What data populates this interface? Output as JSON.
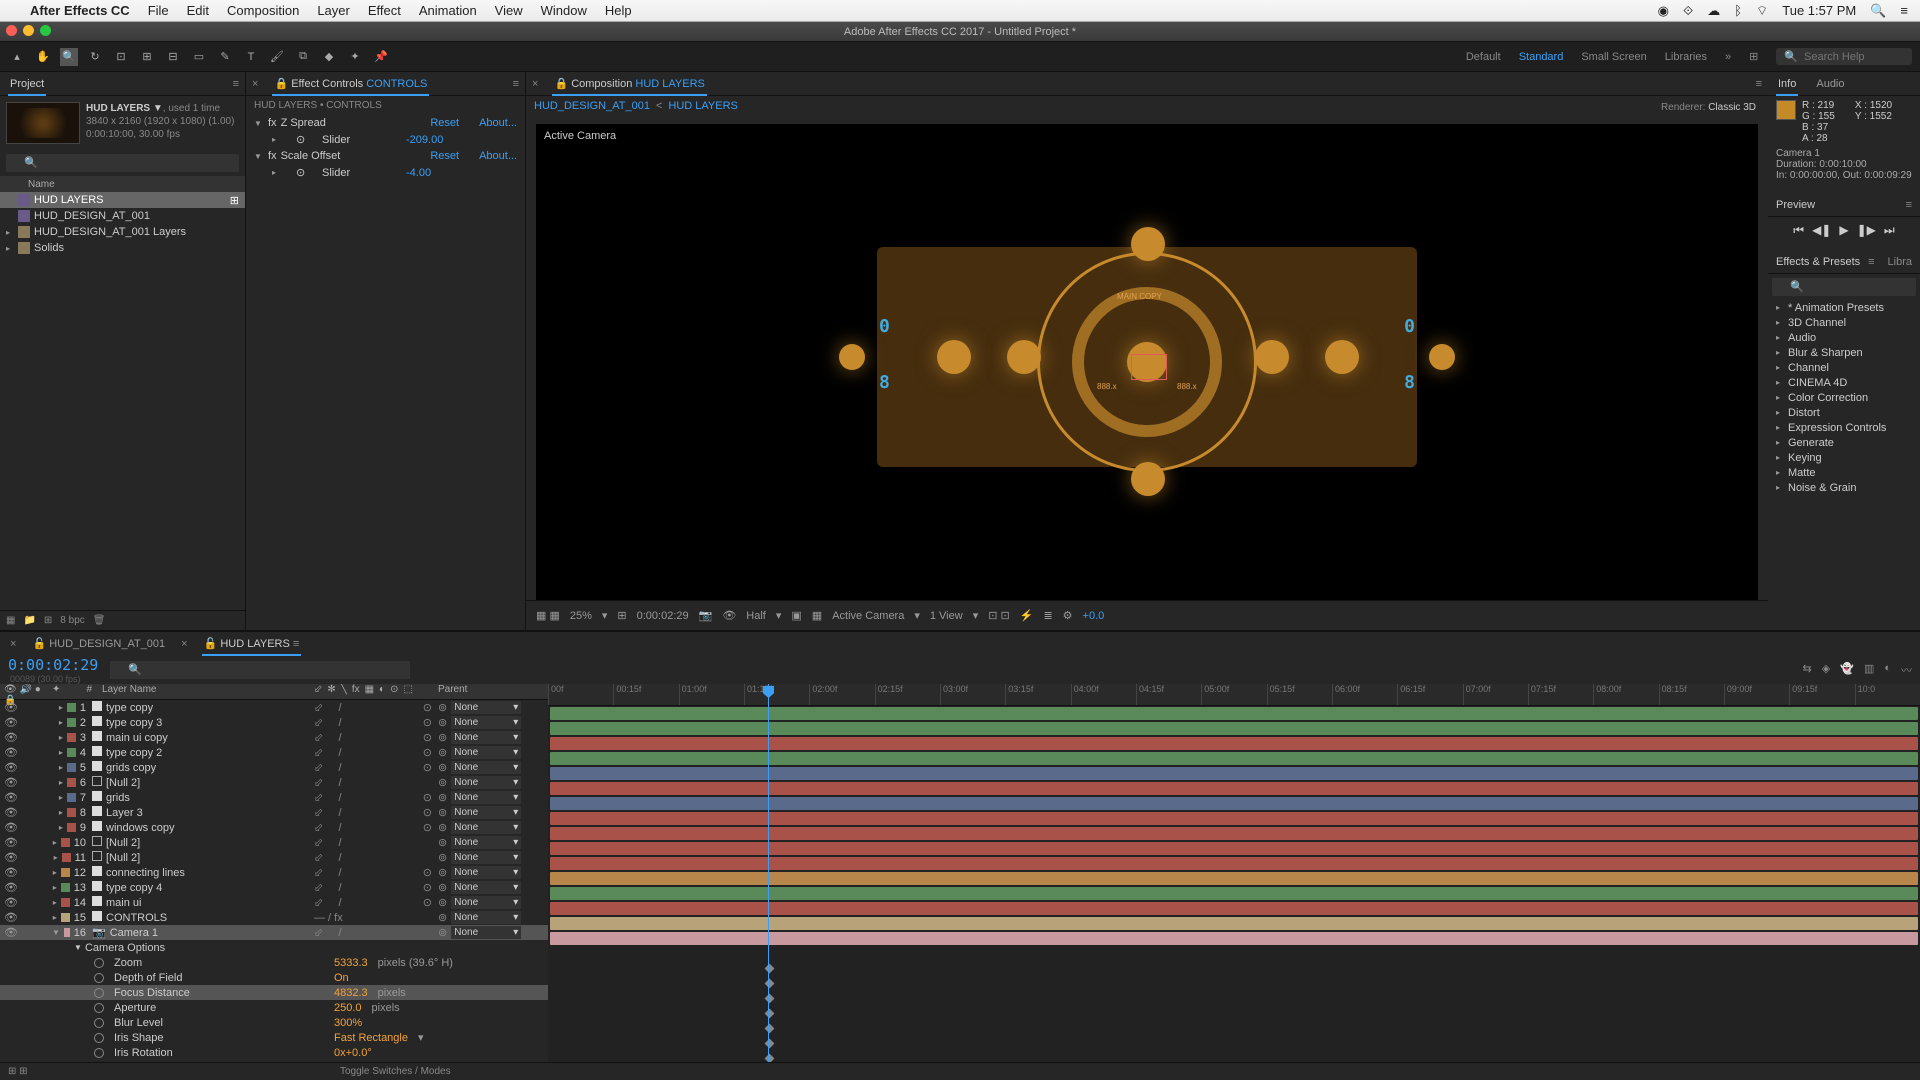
{
  "menubar": {
    "app": "After Effects CC",
    "items": [
      "File",
      "Edit",
      "Composition",
      "Layer",
      "Effect",
      "Animation",
      "View",
      "Window",
      "Help"
    ],
    "status_time": "Tue 1:57 PM"
  },
  "document_title": "Adobe After Effects CC 2017 - Untitled Project *",
  "workspaces": {
    "default": "Default",
    "standard": "Standard",
    "small": "Small Screen",
    "libraries": "Libraries",
    "search_placeholder": "Search Help"
  },
  "project": {
    "tab": "Project",
    "footage_name": "HUD LAYERS ▼",
    "footage_used": ", used 1 time",
    "res": "3840 x 2160  (1920 x 1080) (1.00)",
    "dur": "0:00:10:00, 30.00 fps",
    "column_header": "Name",
    "items": [
      {
        "name": "HUD LAYERS",
        "type": "comp",
        "sel": true,
        "indent": 0
      },
      {
        "name": "HUD_DESIGN_AT_001",
        "type": "comp",
        "sel": false,
        "indent": 0
      },
      {
        "name": "HUD_DESIGN_AT_001 Layers",
        "type": "folder",
        "sel": false,
        "indent": 0,
        "closed": true
      },
      {
        "name": "Solids",
        "type": "folder",
        "sel": false,
        "indent": 0,
        "closed": true
      }
    ],
    "footer_bpc": "8 bpc"
  },
  "effect_controls": {
    "tab_label": "Effect Controls",
    "tab_target": "CONTROLS",
    "path": "HUD LAYERS • CONTROLS",
    "effects": [
      {
        "name": "Z Spread",
        "reset": "Reset",
        "about": "About...",
        "slider_label": "Slider",
        "slider_val": "-209.00"
      },
      {
        "name": "Scale Offset",
        "reset": "Reset",
        "about": "About...",
        "slider_label": "Slider",
        "slider_val": "-4.00"
      }
    ]
  },
  "composition": {
    "tab_label": "Composition",
    "tab_target": "HUD LAYERS",
    "path_a": "HUD_DESIGN_AT_001",
    "path_sep": "<",
    "path_b": "HUD LAYERS",
    "renderer_label": "Renderer:",
    "renderer_val": "Classic 3D",
    "active_cam": "Active Camera",
    "hud": {
      "left_num": "0",
      "left_num2": "8",
      "right_num": "0",
      "right_num2": "8",
      "main": "MAIN COPY",
      "aux": "888.x"
    },
    "footer": {
      "mag": "25%",
      "time": "0:00:02:29",
      "res": "Half",
      "cam": "Active Camera",
      "views": "1 View",
      "exposure": "+0.0"
    }
  },
  "info": {
    "tab_info": "Info",
    "tab_audio": "Audio",
    "r": "R : 219",
    "g": "G : 155",
    "b": "B : 37",
    "a": "A : 28",
    "x": "X : 1520",
    "y": "Y : 1552",
    "cam": "Camera 1",
    "dur": "Duration:  0:00:10:00",
    "in_out": "In: 0:00:00:00, Out: 0:00:09:29"
  },
  "preview": {
    "tab": "Preview"
  },
  "effects_presets": {
    "tab": "Effects & Presets",
    "tab2": "Libra",
    "items": [
      "* Animation Presets",
      "3D Channel",
      "Audio",
      "Blur & Sharpen",
      "Channel",
      "CINEMA 4D",
      "Color Correction",
      "Distort",
      "Expression Controls",
      "Generate",
      "Keying",
      "Matte",
      "Noise & Grain"
    ]
  },
  "timeline": {
    "tabs": [
      {
        "name": "HUD_DESIGN_AT_001",
        "active": false
      },
      {
        "name": "HUD LAYERS",
        "active": true
      }
    ],
    "timecode": "0:00:02:29",
    "timecode_sub": "00089 (30.00 fps)",
    "columns": {
      "layer_name": "Layer Name",
      "parent": "Parent"
    },
    "ruler": [
      "00f",
      "00:15f",
      "01:00f",
      "01:15f",
      "02:00f",
      "02:15f",
      "03:00f",
      "03:15f",
      "04:00f",
      "04:15f",
      "05:00f",
      "05:15f",
      "06:00f",
      "06:15f",
      "07:00f",
      "07:15f",
      "08:00f",
      "08:15f",
      "09:00f",
      "09:15f",
      "10:0"
    ],
    "layers": [
      {
        "idx": "1",
        "color": "#5a8a5a",
        "name": "type copy",
        "ico": "solid",
        "bar": "green",
        "parent": "None",
        "threed": true
      },
      {
        "idx": "2",
        "color": "#5a8a5a",
        "name": "type copy 3",
        "ico": "solid",
        "bar": "green",
        "parent": "None",
        "threed": true
      },
      {
        "idx": "3",
        "color": "#a8524a",
        "name": "main ui copy",
        "ico": "solid",
        "bar": "red",
        "parent": "None",
        "threed": true
      },
      {
        "idx": "4",
        "color": "#5a8a5a",
        "name": "type copy 2",
        "ico": "solid",
        "bar": "green",
        "parent": "None",
        "threed": true
      },
      {
        "idx": "5",
        "color": "#5a6a8a",
        "name": "grids copy",
        "ico": "solid",
        "bar": "blue",
        "parent": "None",
        "threed": true
      },
      {
        "idx": "6",
        "color": "#a8524a",
        "name": "[Null 2]",
        "ico": "null",
        "bar": "red",
        "parent": "None"
      },
      {
        "idx": "7",
        "color": "#5a6a8a",
        "name": "grids",
        "ico": "solid",
        "bar": "blue",
        "parent": "None",
        "threed": true
      },
      {
        "idx": "8",
        "color": "#a8524a",
        "name": "Layer 3",
        "ico": "solid",
        "bar": "red",
        "parent": "None",
        "threed": true
      },
      {
        "idx": "9",
        "color": "#a8524a",
        "name": "windows copy",
        "ico": "solid",
        "bar": "red",
        "parent": "None",
        "threed": true
      },
      {
        "idx": "10",
        "color": "#a8524a",
        "name": "[Null 2]",
        "ico": "null",
        "bar": "red",
        "parent": "None"
      },
      {
        "idx": "11",
        "color": "#a8524a",
        "name": "[Null 2]",
        "ico": "null",
        "bar": "red",
        "parent": "None"
      },
      {
        "idx": "12",
        "color": "#b8864a",
        "name": "connecting lines",
        "ico": "solid",
        "bar": "orange",
        "parent": "None",
        "threed": true
      },
      {
        "idx": "13",
        "color": "#5a8a5a",
        "name": "type copy 4",
        "ico": "solid",
        "bar": "green",
        "parent": "None",
        "threed": true
      },
      {
        "idx": "14",
        "color": "#a8524a",
        "name": "main ui",
        "ico": "solid",
        "bar": "red",
        "parent": "None",
        "threed": true
      },
      {
        "idx": "15",
        "color": "#b8a27a",
        "name": "CONTROLS",
        "ico": "solid",
        "bar": "tan",
        "parent": "None",
        "fx": true
      },
      {
        "idx": "16",
        "color": "#c89aa0",
        "name": "Camera 1",
        "ico": "cam",
        "bar": "pink",
        "parent": "None",
        "sel": true,
        "open": true
      }
    ],
    "cam_header": "Camera Options",
    "cam_props": [
      {
        "name": "Zoom",
        "val": "5333.3",
        "unit": " pixels (39.6° H)"
      },
      {
        "name": "Depth of Field",
        "val": "On",
        "unit": ""
      },
      {
        "name": "Focus Distance",
        "val": "4832.3",
        "unit": " pixels",
        "sel": true
      },
      {
        "name": "Aperture",
        "val": "250.0",
        "unit": " pixels"
      },
      {
        "name": "Blur Level",
        "val": "300%",
        "unit": ""
      },
      {
        "name": "Iris Shape",
        "val": "Fast Rectangle",
        "unit": "",
        "dropdown": true
      },
      {
        "name": "Iris Rotation",
        "val": "0x+0.0°",
        "unit": ""
      }
    ],
    "footer_toggle": "Toggle Switches / Modes"
  }
}
